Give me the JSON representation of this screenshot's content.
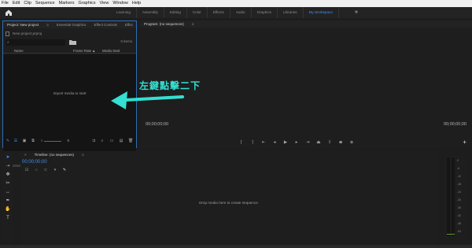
{
  "menu": [
    "File",
    "Edit",
    "Clip",
    "Sequence",
    "Markers",
    "Graphics",
    "View",
    "Window",
    "Help"
  ],
  "workspaces": {
    "tabs": [
      "Learning",
      "Assembly",
      "Editing",
      "Color",
      "Effects",
      "Audio",
      "Graphics",
      "Libraries",
      "My Workspace"
    ],
    "active": "My Workspace",
    "more_icon": "double-chevron-right-icon"
  },
  "project_panel": {
    "tabs": [
      "Project: New project",
      "Essential Graphics",
      "Effect Controls",
      "Effec"
    ],
    "file": "New project.prproj",
    "items_count": "0 items",
    "columns": [
      "Name",
      "Frame Rate",
      "Media Start"
    ],
    "empty_message": "Import media to start"
  },
  "program_monitor": {
    "title": "Program: (no sequences)",
    "timecode_left": "00;00;00;00",
    "timecode_right": "00;00;00;00",
    "transport_icons": [
      "mark-in-icon",
      "mark-out-icon",
      "go-to-in-icon",
      "step-back-icon",
      "play-icon",
      "step-forward-icon",
      "go-to-out-icon",
      "lift-icon",
      "extract-icon",
      "export-frame-icon",
      "compare-icon"
    ],
    "add_button": "+"
  },
  "timeline": {
    "title": "Timeline: (no sequences)",
    "timecode": "00;00;00;00",
    "empty_message": "Drop media here to create sequence."
  },
  "audio_meter": {
    "ticks": [
      "0",
      "-6",
      "-12",
      "-18",
      "-24",
      "-30",
      "-36",
      "-42",
      "-48",
      "-54"
    ]
  },
  "annotation": {
    "text": "左鍵點擊二下",
    "color": "#33e0d2"
  },
  "colors": {
    "accent": "#3e8ff0",
    "panel_focus_border": "#2f6eb5",
    "background": "#1d1d1d"
  }
}
